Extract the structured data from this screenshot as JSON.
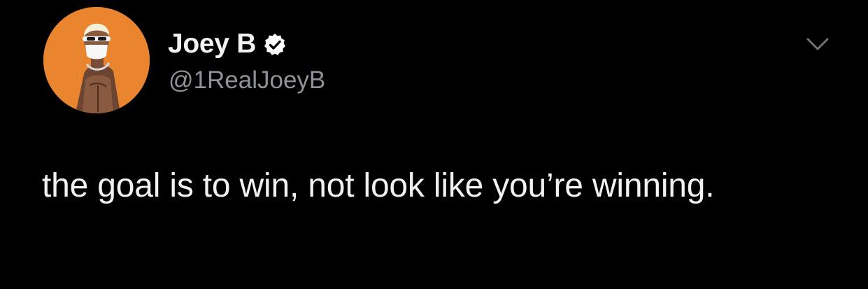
{
  "author": {
    "display_name": "Joey B",
    "handle": "@1RealJoeyB",
    "verified": true,
    "avatar_icon": "profile-avatar-illustration"
  },
  "tweet": {
    "text": "the goal is to win, not look like you’re winning."
  },
  "more_button": {
    "icon": "chevron-down-icon"
  },
  "colors": {
    "background": "#000000",
    "name": "#f2f2f2",
    "handle": "#8e939a",
    "avatar_background": "#e9852f",
    "verified_badge": "#ffffff"
  }
}
